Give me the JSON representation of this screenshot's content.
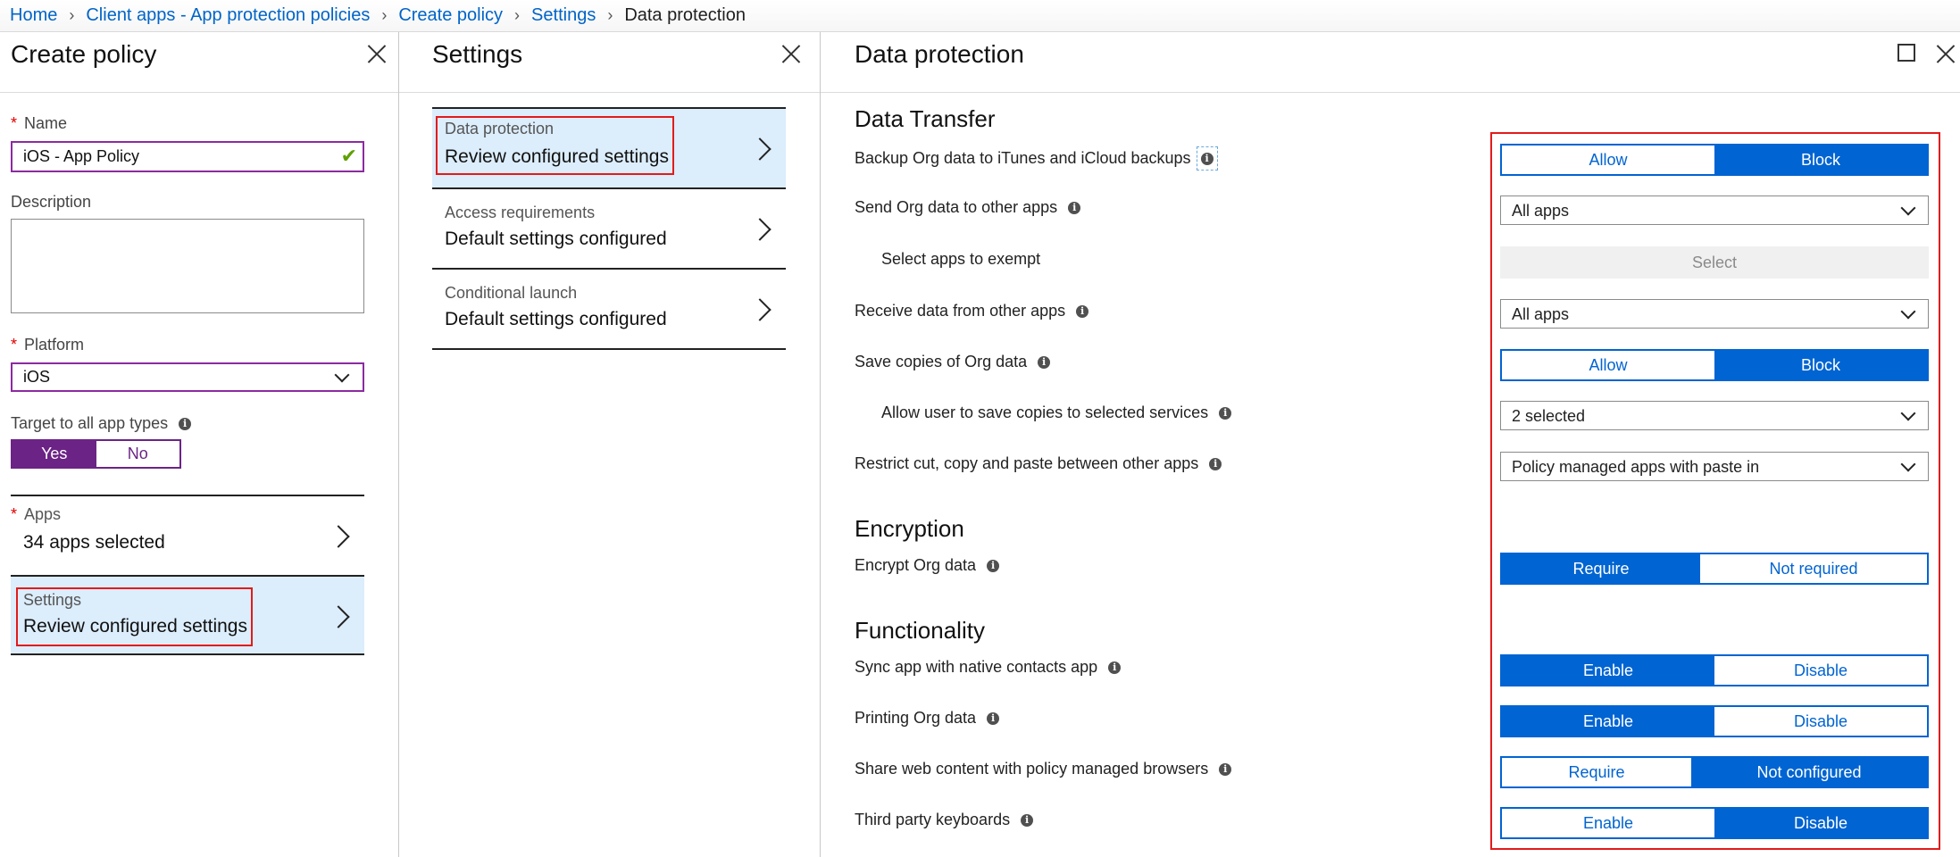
{
  "breadcrumb": {
    "items": [
      "Home",
      "Client apps - App protection policies",
      "Create policy",
      "Settings"
    ],
    "current": "Data protection"
  },
  "create_policy": {
    "title": "Create policy",
    "name_label": "Name",
    "name_value": "iOS - App Policy",
    "description_label": "Description",
    "platform_label": "Platform",
    "platform_value": "iOS",
    "target_label": "Target to all app types",
    "target_yes": "Yes",
    "target_no": "No",
    "target_selected": "Yes",
    "apps_sub": "Apps",
    "apps_main": "34 apps selected",
    "settings_sub": "Settings",
    "settings_main": "Review configured settings"
  },
  "settings_blade": {
    "title": "Settings",
    "items": [
      {
        "sub": "Data protection",
        "main": "Review configured settings"
      },
      {
        "sub": "Access requirements",
        "main": "Default settings configured"
      },
      {
        "sub": "Conditional launch",
        "main": "Default settings configured"
      }
    ]
  },
  "data_protection": {
    "title": "Data protection",
    "data_transfer": {
      "title": "Data Transfer",
      "backup_label": "Backup Org data to iTunes and iCloud backups",
      "backup_options": [
        "Allow",
        "Block"
      ],
      "backup_selected": "Block",
      "send_label": "Send Org data to other apps",
      "send_value": "All apps",
      "exempt_label": "Select apps to exempt",
      "exempt_button": "Select",
      "receive_label": "Receive data from other apps",
      "receive_value": "All apps",
      "save_label": "Save copies of Org data",
      "save_options": [
        "Allow",
        "Block"
      ],
      "save_selected": "Block",
      "save_services_label": "Allow user to save copies to selected services",
      "save_services_value": "2 selected",
      "restrict_label": "Restrict cut, copy and paste between other apps",
      "restrict_value": "Policy managed apps with paste in"
    },
    "encryption": {
      "title": "Encryption",
      "encrypt_label": "Encrypt Org data",
      "encrypt_options": [
        "Require",
        "Not required"
      ],
      "encrypt_selected": "Require"
    },
    "functionality": {
      "title": "Functionality",
      "sync_label": "Sync app with native contacts app",
      "sync_options": [
        "Enable",
        "Disable"
      ],
      "sync_selected": "Enable",
      "printing_label": "Printing Org data",
      "printing_options": [
        "Enable",
        "Disable"
      ],
      "printing_selected": "Enable",
      "share_label": "Share web content with policy managed browsers",
      "share_options": [
        "Require",
        "Not configured"
      ],
      "share_selected": "Not configured",
      "keyboards_label": "Third party keyboards",
      "keyboards_options": [
        "Enable",
        "Disable"
      ],
      "keyboards_selected": "Disable"
    }
  },
  "colors": {
    "link": "#0064c8",
    "toggle_blue": "#0064d2",
    "toggle_purple": "#6b2385",
    "highlight_red": "#e21b1b",
    "selected_row": "#dcedfc"
  }
}
